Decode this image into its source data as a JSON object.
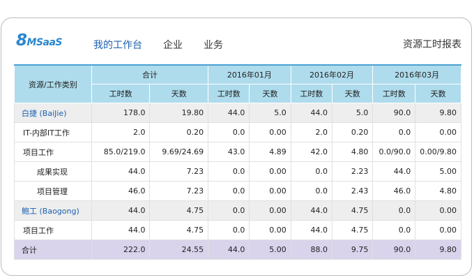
{
  "brand": {
    "logo_big": "8",
    "logo_small": "MSaaS"
  },
  "nav": {
    "items": [
      {
        "label": "我的工作台"
      },
      {
        "label": "企业"
      },
      {
        "label": "业务"
      }
    ]
  },
  "report_title": "资源工时报表",
  "table": {
    "row_header": "资源/工作类别",
    "groups": [
      "合计",
      "2016年01月",
      "2016年02月",
      "2016年03月"
    ],
    "subheaders": [
      "工时数",
      "天数",
      "工时数",
      "天数",
      "工时数",
      "天数",
      "工时数",
      "天数"
    ],
    "rows": [
      {
        "label": "白捷 (BaiJie)",
        "type": "group",
        "values": [
          "178.0",
          "19.80",
          "44.0",
          "5.0",
          "44.0",
          "5.0",
          "90.0",
          "9.80"
        ]
      },
      {
        "label": "IT-内部IT工作",
        "type": "level1",
        "values": [
          "2.0",
          "0.20",
          "0.0",
          "0.00",
          "2.0",
          "0.20",
          "0.0",
          "0.00"
        ]
      },
      {
        "label": "项目工作",
        "type": "level1",
        "values": [
          "85.0/219.0",
          "9.69/24.69",
          "43.0",
          "4.89",
          "42.0",
          "4.80",
          "0.0/90.0",
          "0.00/9.80"
        ]
      },
      {
        "label": "成果实现",
        "type": "level2",
        "values": [
          "44.0",
          "7.23",
          "0.0",
          "0.00",
          "0.0",
          "2.23",
          "44.0",
          "5.00"
        ]
      },
      {
        "label": "项目管理",
        "type": "level2",
        "values": [
          "46.0",
          "7.23",
          "0.0",
          "0.00",
          "0.0",
          "2.43",
          "46.0",
          "4.80"
        ]
      },
      {
        "label": "鲍工 (Baogong)",
        "type": "group",
        "values": [
          "44.0",
          "4.75",
          "0.0",
          "0.00",
          "44.0",
          "4.75",
          "0.0",
          "0.00"
        ]
      },
      {
        "label": "项目工作",
        "type": "level1",
        "values": [
          "44.0",
          "4.75",
          "0.0",
          "0.00",
          "44.0",
          "4.75",
          "0.0",
          "0.00"
        ]
      },
      {
        "label": "合计",
        "type": "total",
        "values": [
          "222.0",
          "24.55",
          "44.0",
          "5.00",
          "88.0",
          "9.75",
          "90.0",
          "9.80"
        ]
      }
    ]
  },
  "colors": {
    "header_bg": "#aedcec",
    "group_row_bg": "#eeeeee",
    "total_row_bg": "#d9d3ec",
    "accent": "#1b5fb0"
  }
}
